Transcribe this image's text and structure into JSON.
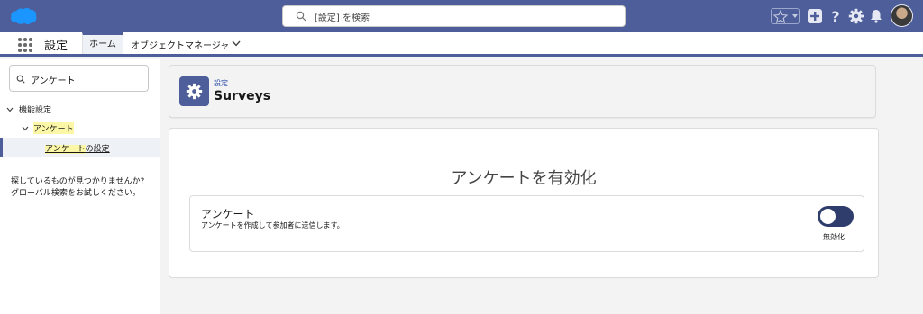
{
  "header": {
    "search_text": "[設定] を検索"
  },
  "nav": {
    "app_name": "設定",
    "tabs": [
      {
        "label": "ホーム"
      },
      {
        "label": "オブジェクトマネージャ"
      }
    ]
  },
  "sidebar": {
    "quick_find_value": "アンケート",
    "tree": {
      "root_label": "機能設定",
      "group_label": "アンケート",
      "item_highlight": "アンケート",
      "item_rest": "の設定"
    },
    "help_line1": "探しているものが見つかりませんか?",
    "help_line2": "グローバル検索をお試しください。"
  },
  "page_header": {
    "breadcrumb": "設定",
    "title": "Surveys"
  },
  "card": {
    "title": "アンケートを有効化",
    "setting": {
      "name": "アンケート",
      "description": "アンケートを作成して参加者に送信します。",
      "toggle_state_label": "無効化"
    }
  },
  "colors": {
    "brand": "#4d5e9a",
    "toggle": "#2f3d6c",
    "highlight": "#fbf7a6",
    "link": "#2d4da8"
  }
}
